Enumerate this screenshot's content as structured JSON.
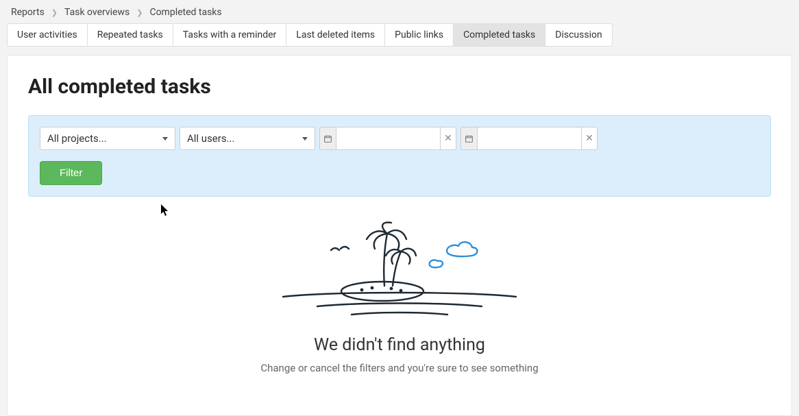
{
  "breadcrumb": {
    "items": [
      "Reports",
      "Task overviews",
      "Completed tasks"
    ]
  },
  "tabs": {
    "items": [
      {
        "label": "User activities",
        "active": false
      },
      {
        "label": "Repeated tasks",
        "active": false
      },
      {
        "label": "Tasks with a reminder",
        "active": false
      },
      {
        "label": "Last deleted items",
        "active": false
      },
      {
        "label": "Public links",
        "active": false
      },
      {
        "label": "Completed tasks",
        "active": true
      },
      {
        "label": "Discussion",
        "active": false
      }
    ]
  },
  "page": {
    "title": "All completed tasks"
  },
  "filters": {
    "project_select": "All projects...",
    "user_select": "All users...",
    "date_from": "",
    "date_to": "",
    "button_label": "Filter"
  },
  "empty": {
    "title": "We didn't find anything",
    "subtitle": "Change or cancel the filters and you're sure to see something"
  }
}
